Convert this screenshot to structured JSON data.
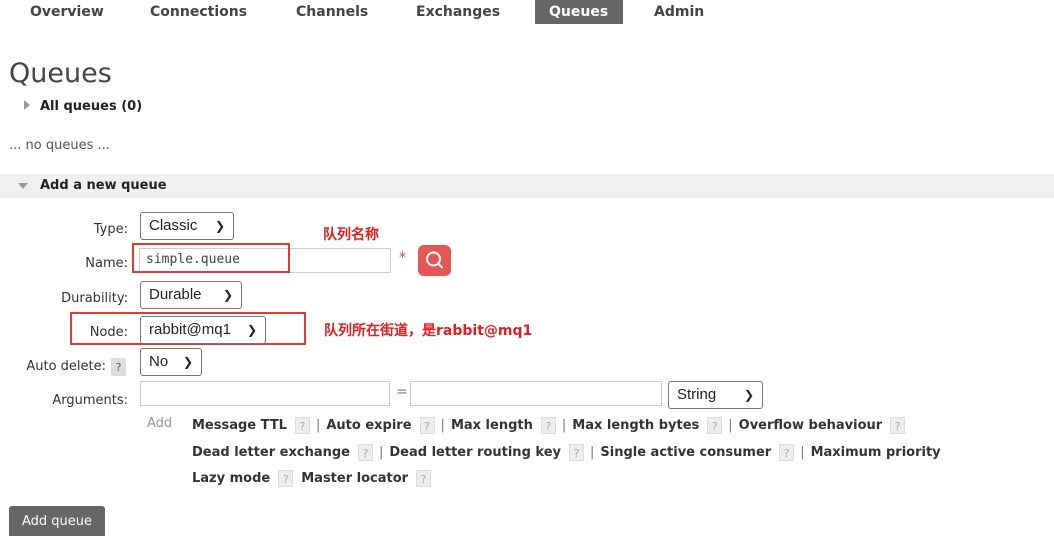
{
  "nav": {
    "tabs": [
      {
        "label": "Overview"
      },
      {
        "label": "Connections"
      },
      {
        "label": "Channels"
      },
      {
        "label": "Exchanges"
      },
      {
        "label": "Queues",
        "active": true
      },
      {
        "label": "Admin"
      }
    ]
  },
  "page": {
    "title": "Queues",
    "all_queues_label": "All queues (0)",
    "no_queues_text": "... no queues ...",
    "add_section_label": "Add a new queue"
  },
  "form": {
    "type_label": "Type:",
    "type_value": "Classic",
    "name_label": "Name:",
    "name_value": "simple.queue",
    "required_mark": "*",
    "durability_label": "Durability:",
    "durability_value": "Durable",
    "node_label": "Node:",
    "node_value": "rabbit@mq1",
    "auto_delete_label": "Auto delete:",
    "auto_delete_help": "?",
    "auto_delete_value": "No",
    "arguments_label": "Arguments:",
    "arguments_eq": "=",
    "arguments_type_value": "String",
    "add_label": "Add",
    "arg_links_row1": [
      "Message TTL",
      "Auto expire",
      "Max length",
      "Max length bytes",
      "Overflow behaviour"
    ],
    "arg_links_row2": [
      "Dead letter exchange",
      "Dead letter routing key",
      "Single active consumer",
      "Maximum priority"
    ],
    "arg_links_row3": [
      "Lazy mode",
      "Master locator"
    ],
    "help_mark": "?",
    "separator": "|"
  },
  "annotations": {
    "name_note": "队列名称",
    "node_note": "队列所在街道，是rabbit@mq1"
  },
  "buttons": {
    "add_queue": "Add queue"
  },
  "icons": {
    "search": "search-icon",
    "expand_all_queues": "triangle-right-icon",
    "collapse_add_queue": "triangle-down-icon",
    "dropdown": "chevron-down-icon"
  },
  "colors": {
    "active_tab": "#666666",
    "annotation_red": "#e02020",
    "search_button": "#e35757",
    "add_queue_button": "#666666"
  }
}
